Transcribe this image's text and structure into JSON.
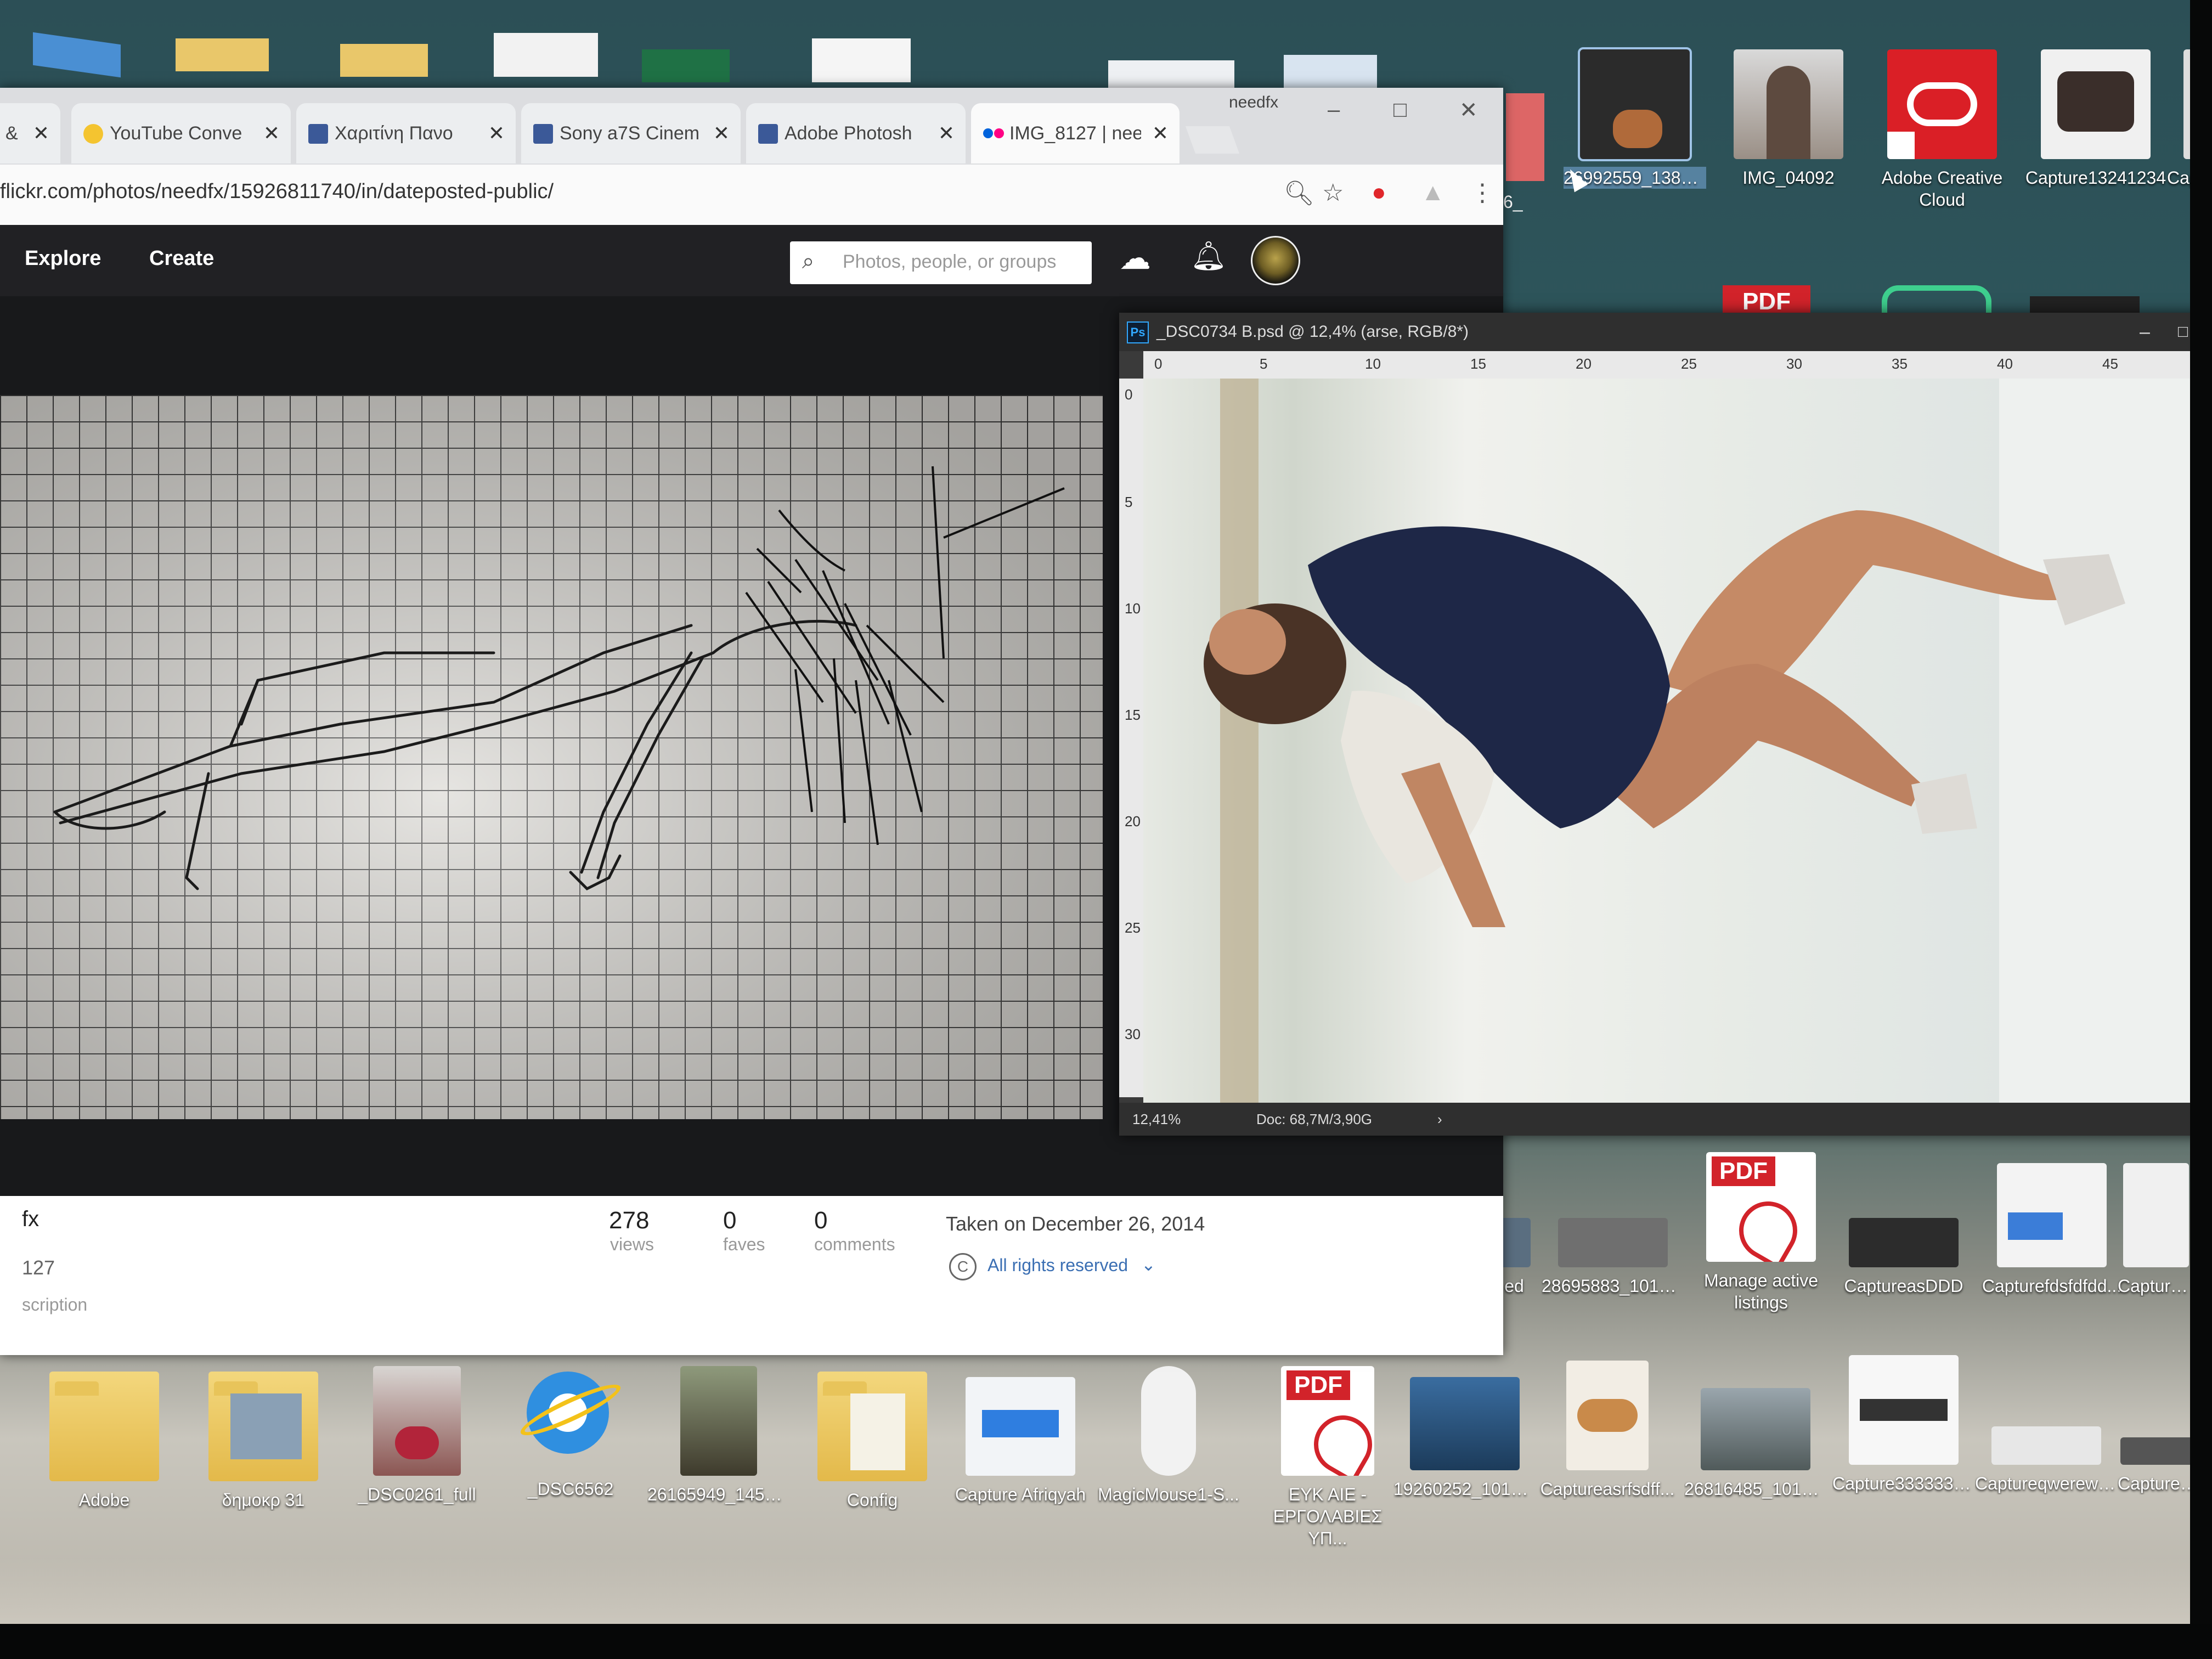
{
  "browser": {
    "tabs": [
      {
        "title": "&",
        "icon": "blank"
      },
      {
        "title": "YouTube Conve",
        "icon": "youtube-converter-icon"
      },
      {
        "title": "Χαριτίνη Πανο",
        "icon": "facebook-icon"
      },
      {
        "title": "Sony a7S Cinem",
        "icon": "facebook-icon"
      },
      {
        "title": "Adobe Photosh",
        "icon": "facebook-icon"
      },
      {
        "title": "IMG_8127 | nee",
        "icon": "flickr-icon"
      }
    ],
    "profile_label": "needfx",
    "url": "flickr.com/photos/needfx/15926811740/in/dateposted-public/"
  },
  "flickr": {
    "nav": {
      "explore": "Explore",
      "create": "Create"
    },
    "search_placeholder": "Photos, people, or groups",
    "stats": [
      {
        "value": "278",
        "label": "views"
      },
      {
        "value": "0",
        "label": "faves"
      },
      {
        "value": "0",
        "label": "comments"
      }
    ],
    "taken": "Taken on December 26, 2014",
    "rights": "All rights reserved",
    "owner_fragment": "fx",
    "title_fragment": "127",
    "description_fragment": "scription"
  },
  "photoshop": {
    "title": "_DSC0734 B.psd @ 12,4% (arse, RGB/8*)",
    "ruler_h": [
      "0",
      "5",
      "10",
      "15",
      "20",
      "25",
      "30",
      "35",
      "40",
      "45"
    ],
    "ruler_v": [
      "0",
      "5",
      "10",
      "15",
      "20",
      "25",
      "30"
    ],
    "zoom": "12,41%",
    "doc": "Doc: 68,7M/3,90G"
  },
  "desktop": {
    "top_icons": [
      {
        "label": "26992559_13873...",
        "selected": true
      },
      {
        "label": "IMG_04092"
      },
      {
        "label": "Adobe Creative Cloud"
      },
      {
        "label": "Capture13241234"
      },
      {
        "label": "Capt"
      }
    ],
    "top_left_partial": "6_",
    "right_icons": [
      {
        "label": "ed"
      },
      {
        "label": "28695883_10156..."
      },
      {
        "label": "Manage active listings"
      },
      {
        "label": "CaptureasDDD"
      },
      {
        "label": "Capturefdsfdfdd..."
      },
      {
        "label": "Captureasd"
      }
    ],
    "bottom_icons": [
      {
        "label": "Adobe"
      },
      {
        "label": "δημοκρ 31"
      },
      {
        "label": "_DSC0261_full"
      },
      {
        "label": "_DSC6562"
      },
      {
        "label": "26165949_14552..."
      },
      {
        "label": "Config"
      },
      {
        "label": "Capture Afriqyah"
      },
      {
        "label": "MagicMouse1-S..."
      },
      {
        "label": "ΕΥΚ ΑΙΕ - ΕΡΓΟΛΑΒΙΕΣ ΥΠ..."
      },
      {
        "label": "19260252_10157..."
      },
      {
        "label": "Captureasrfsdff..."
      },
      {
        "label": "26816485_10155..."
      },
      {
        "label": "Capture3333333..."
      },
      {
        "label": "Captureqwerewere"
      },
      {
        "label": "Capturefdsg"
      }
    ]
  },
  "colors": {
    "flickr_nav": "#212124",
    "adobe_red": "#da1f26",
    "pdf_red": "#d2232a",
    "ps_blue": "#31a8ff"
  }
}
